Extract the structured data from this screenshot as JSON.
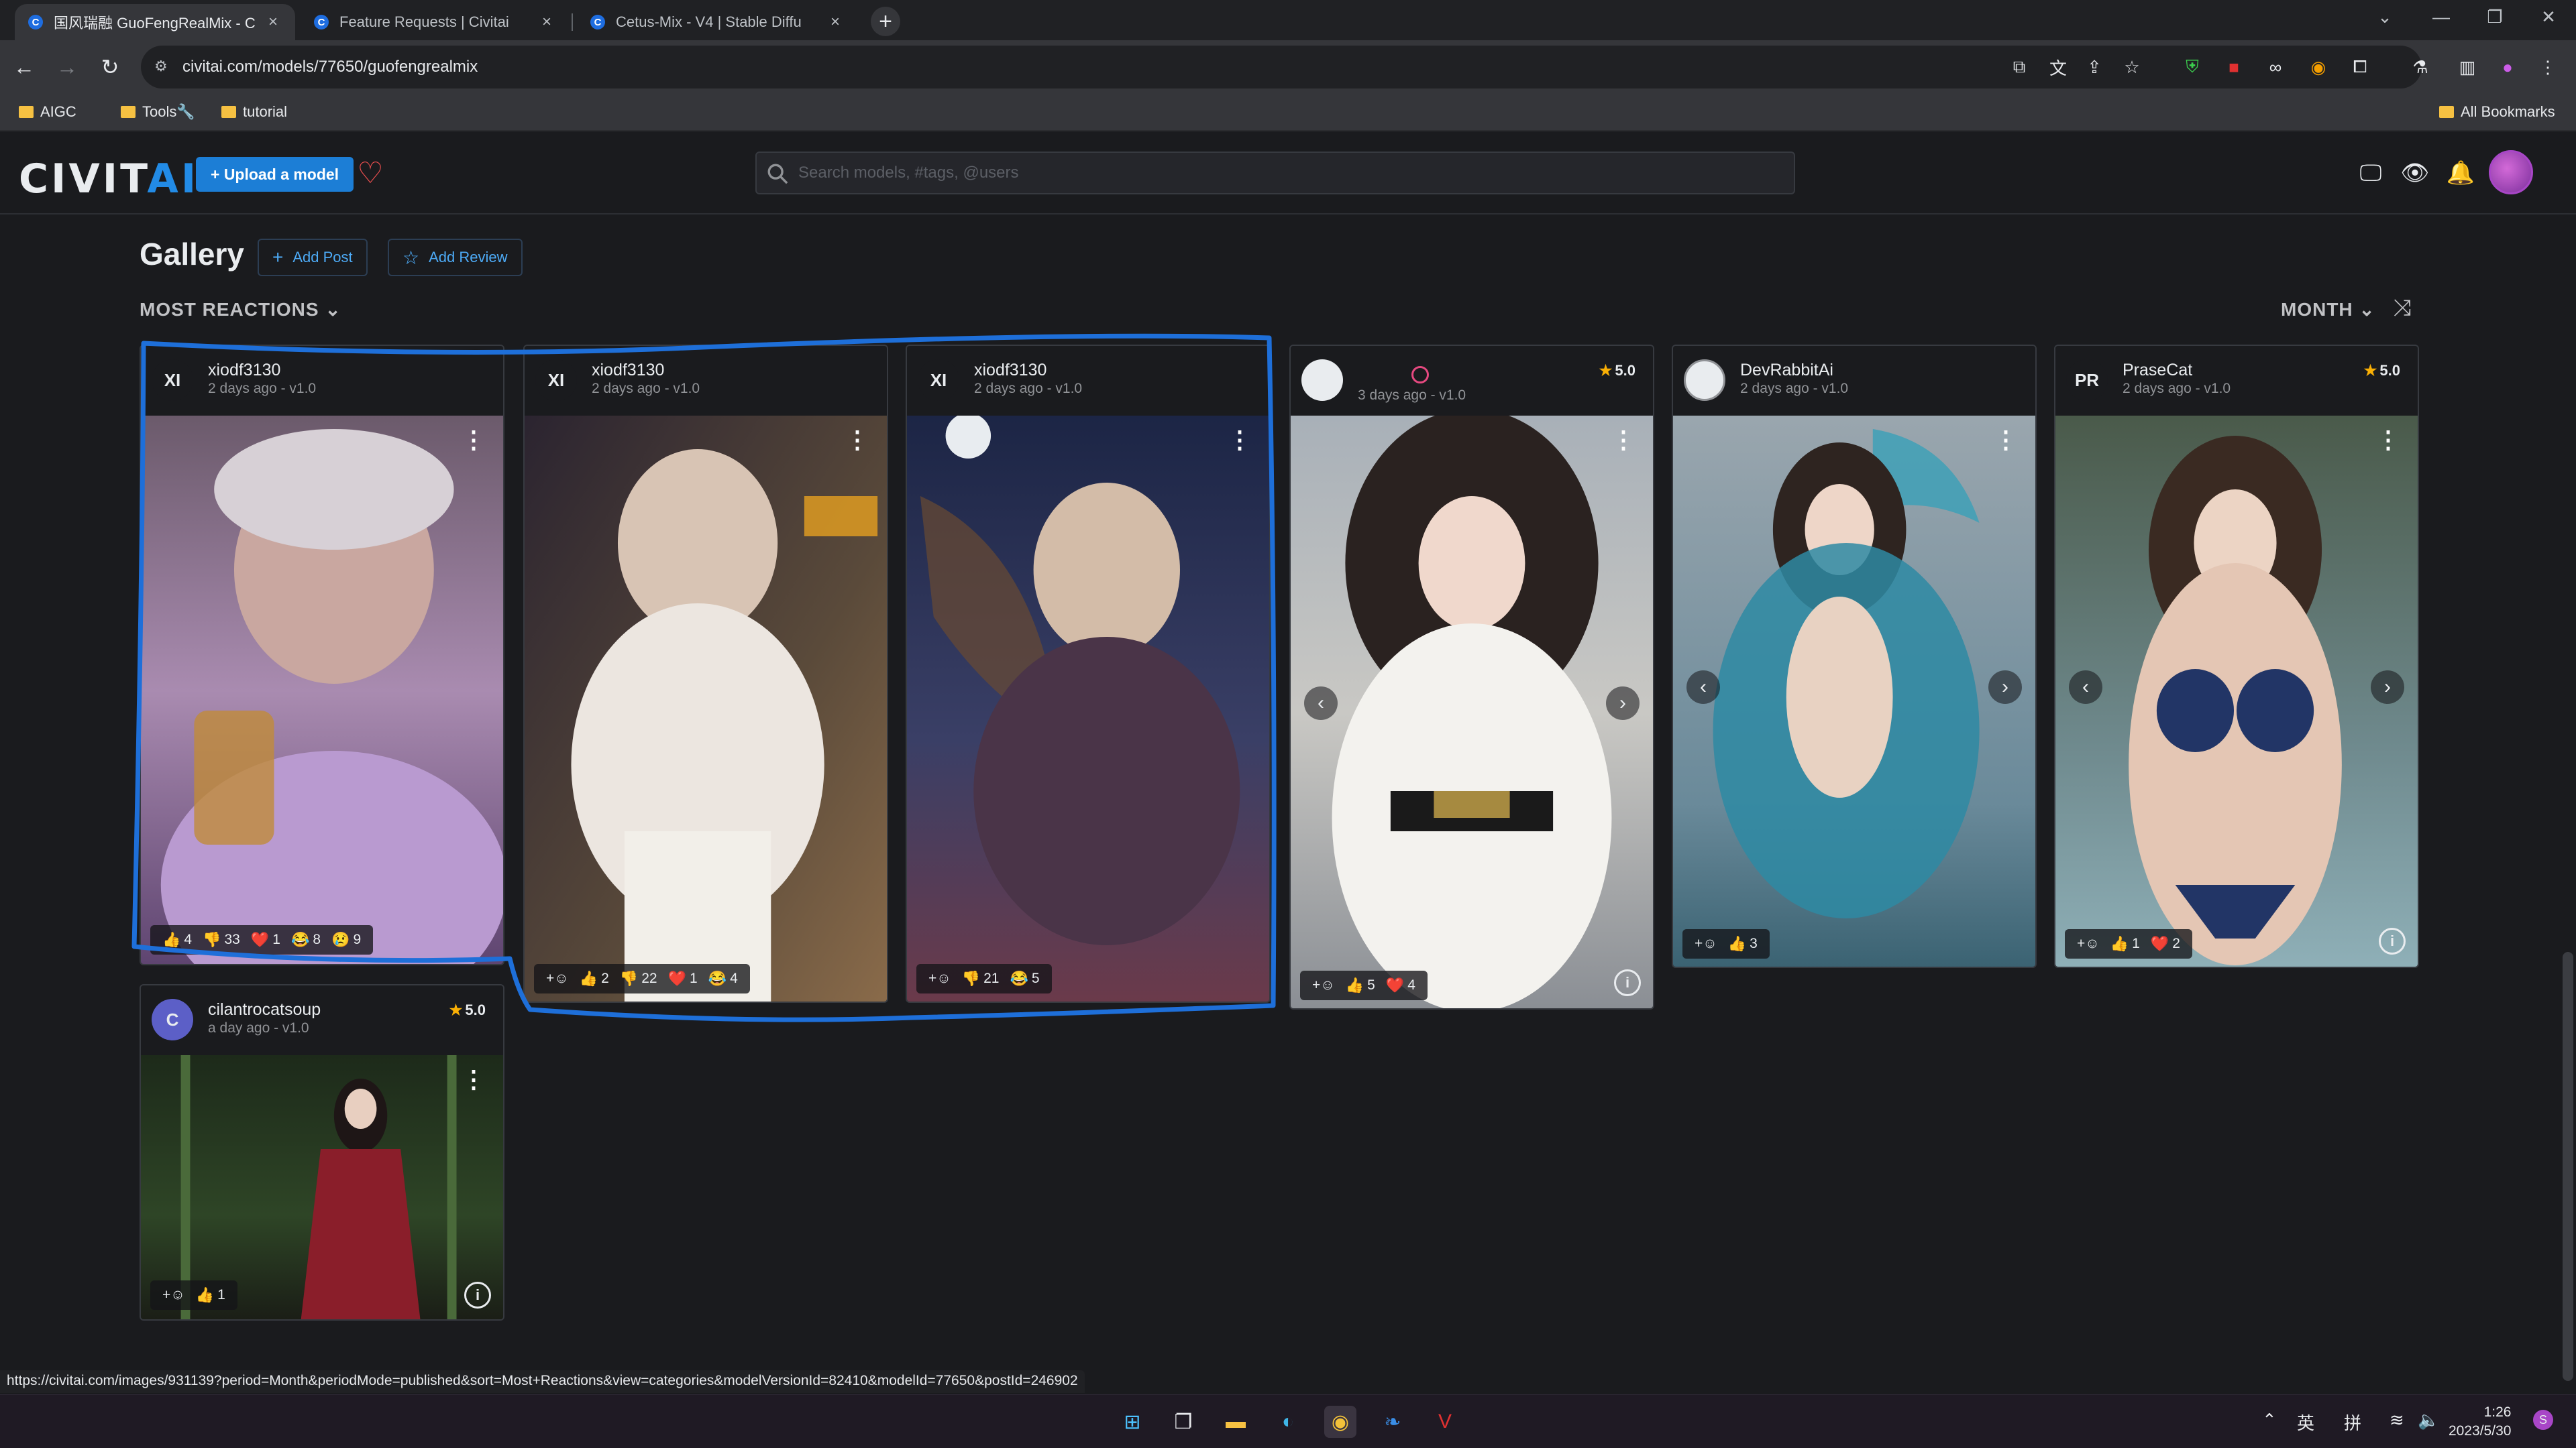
{
  "browser": {
    "tabs": [
      {
        "title": "国风瑞融 GuoFengRealMix - C",
        "active": true
      },
      {
        "title": "Feature Requests | Civitai",
        "active": false
      },
      {
        "title": "Cetus-Mix - V4 | Stable Diffu",
        "active": false
      }
    ],
    "new_tab": "+",
    "url": "civitai.com/models/77650/guofengrealmix",
    "bookmarks": [
      "AIGC",
      "Tools🔧",
      "tutorial"
    ],
    "all_bookmarks": "All Bookmarks",
    "status_url": "https://civitai.com/images/931139?period=Month&periodMode=published&sort=Most+Reactions&view=categories&modelVersionId=82410&modelId=77650&postId=246902"
  },
  "site": {
    "logo_left": "CIVIT",
    "logo_right": "AI",
    "upload_label": "+ Upload a model",
    "search_placeholder": "Search models, #tags, @users"
  },
  "gallery": {
    "title": "Gallery",
    "add_post": "Add Post",
    "add_review": "Add Review",
    "sort": "MOST REACTIONS",
    "period": "MONTH",
    "cards": [
      {
        "initials": "XI",
        "user": "xiodf3130",
        "meta": "2 days ago - v1.0",
        "rating": "",
        "reactions": [
          [
            "👍",
            "4"
          ],
          [
            "👎",
            "33"
          ],
          [
            "❤️",
            "1"
          ],
          [
            "😂",
            "8"
          ],
          [
            "😢",
            "9"
          ]
        ]
      },
      {
        "initials": "XI",
        "user": "xiodf3130",
        "meta": "2 days ago - v1.0",
        "rating": "",
        "reactions": [
          [
            "👍",
            "2"
          ],
          [
            "👎",
            "22"
          ],
          [
            "❤️",
            "1"
          ],
          [
            "😂",
            "4"
          ]
        ]
      },
      {
        "initials": "XI",
        "user": "xiodf3130",
        "meta": "2 days ago - v1.0",
        "rating": "",
        "reactions": [
          [
            "👎",
            "21"
          ],
          [
            "😂",
            "5"
          ]
        ]
      },
      {
        "initials": "",
        "user": "",
        "meta": "3 days ago - v1.0",
        "rating": "5.0",
        "reactions": [
          [
            "👍",
            "5"
          ],
          [
            "❤️",
            "4"
          ]
        ]
      },
      {
        "initials": "",
        "user": "DevRabbitAi",
        "meta": "2 days ago - v1.0",
        "rating": "",
        "reactions": [
          [
            "👍",
            "3"
          ]
        ]
      },
      {
        "initials": "PR",
        "user": "PraseCat",
        "meta": "2 days ago - v1.0",
        "rating": "5.0",
        "reactions": [
          [
            "👍",
            "1"
          ],
          [
            "❤️",
            "2"
          ]
        ]
      },
      {
        "initials": "C",
        "user": "cilantrocatsoup",
        "meta": "a day ago - v1.0",
        "rating": "5.0",
        "reactions": [
          [
            "👍",
            "1"
          ]
        ]
      }
    ]
  },
  "taskbar": {
    "ime1": "英",
    "ime2": "拼",
    "time": "1:26",
    "date": "2023/5/30"
  },
  "colors": {
    "accent": "#1c7ed6",
    "annotation": "#1e6fd9",
    "star": "#fab005"
  }
}
